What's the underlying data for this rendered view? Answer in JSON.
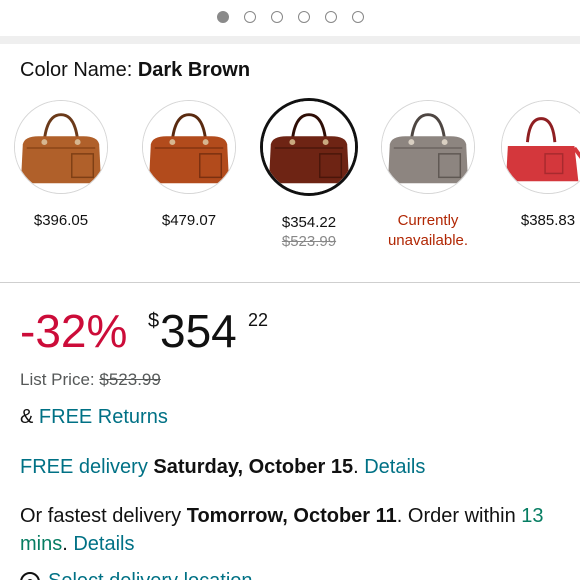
{
  "carousel": {
    "total": 6,
    "active_index": 0
  },
  "color": {
    "label": "Color Name:",
    "value": "Dark Brown"
  },
  "swatches": [
    {
      "price": "$396.05",
      "color": "#b0602a",
      "name": "tan"
    },
    {
      "price": "$479.07",
      "color": "#b24b1c",
      "name": "cognac"
    },
    {
      "price": "$354.22",
      "list_price": "$523.99",
      "color": "#6e2414",
      "name": "dark-brown",
      "selected": true
    },
    {
      "status": "Currently unavailable.",
      "color": "#8d8580",
      "name": "grey"
    },
    {
      "price": "$385.83",
      "color": "#d4373c",
      "name": "red"
    }
  ],
  "pricing": {
    "discount": "-32%",
    "currency": "$",
    "whole": "354",
    "fraction": "22",
    "list_price_label": "List Price:",
    "list_price_value": "$523.99"
  },
  "returns": {
    "prefix": "&",
    "link": "FREE Returns"
  },
  "delivery": {
    "link_prefix": "FREE delivery",
    "date": "Saturday, October 15",
    "period": ".",
    "details_link": "Details"
  },
  "fastest": {
    "text_prefix": "Or fastest delivery",
    "date": "Tomorrow, October 11",
    "order_within": ". Order within",
    "time_left": "13 mins",
    "period": ".",
    "details_link": "Details"
  },
  "location": {
    "text": "Select delivery location"
  },
  "colors": {
    "link": "#007185",
    "discount": "#cc0c39",
    "green": "#067d62",
    "unavailable": "#b12704"
  }
}
